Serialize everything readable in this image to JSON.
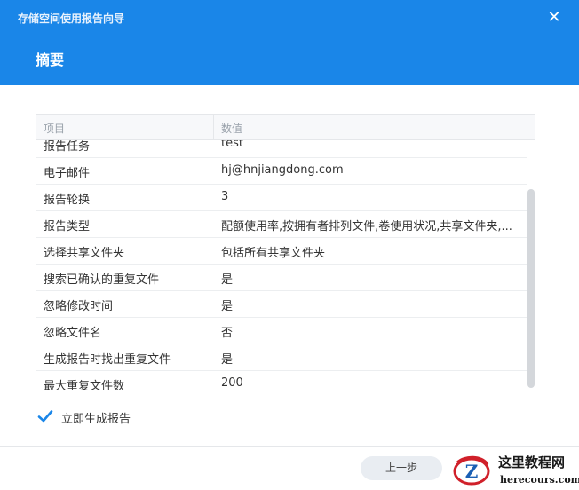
{
  "dialog": {
    "wizard_title": "存储空间使用报告向导",
    "step_title": "摘要",
    "close_symbol": "✕"
  },
  "table": {
    "columns": [
      "项目",
      "数值"
    ],
    "rows": [
      {
        "key": "报告任务",
        "value": "test"
      },
      {
        "key": "电子邮件",
        "value": "hj@hnjiangdong.com"
      },
      {
        "key": "报告轮换",
        "value": "3"
      },
      {
        "key": "报告类型",
        "value": "配额使用率,按拥有者排列文件,卷使用状况,共享文件夹,..."
      },
      {
        "key": "选择共享文件夹",
        "value": "包括所有共享文件夹"
      },
      {
        "key": "搜索已确认的重复文件",
        "value": "是"
      },
      {
        "key": "忽略修改时间",
        "value": "是"
      },
      {
        "key": "忽略文件名",
        "value": "否"
      },
      {
        "key": "生成报告时找出重复文件",
        "value": "是"
      },
      {
        "key": "最大重复文件数",
        "value": "200"
      }
    ]
  },
  "options": {
    "generate_now_label": "立即生成报告",
    "generate_now_checked": true
  },
  "footer": {
    "prev_label": "上一步"
  },
  "watermark": {
    "title": "这里教程网",
    "url": "herecours.com"
  },
  "colors": {
    "header_blue": "#1a86e8",
    "check_blue": "#1a86e8",
    "watermark_red": "#d0202a"
  }
}
